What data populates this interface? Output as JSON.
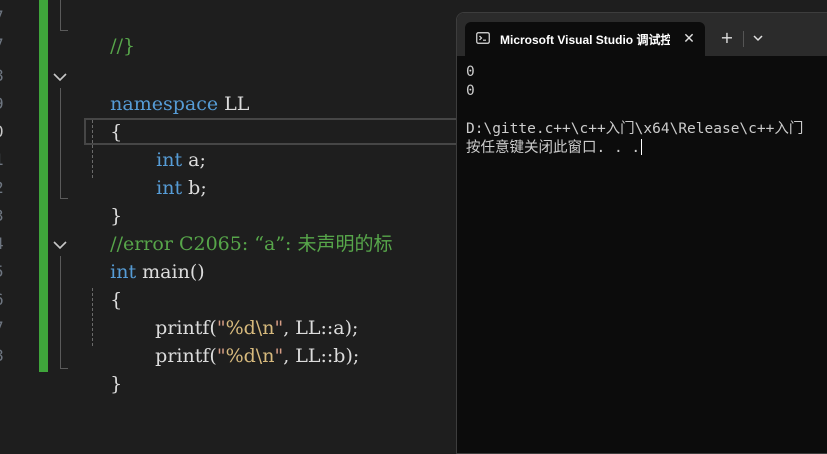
{
  "editor": {
    "lines": {
      "l1": {
        "text": "//}"
      },
      "l3": {
        "kw": "namespace",
        "name": " LL"
      },
      "l4": {
        "text": "{"
      },
      "l5": {
        "kw": "int",
        "rest": " a;"
      },
      "l6": {
        "kw": "int",
        "rest": " b;"
      },
      "l7": {
        "text": "}"
      },
      "l8": {
        "text": "//error C2065: “a”: 未声明的标"
      },
      "l9": {
        "kw": "int",
        "rest": " main()"
      },
      "l10": {
        "text": "{"
      },
      "l11": {
        "fn": "printf",
        "open": "(",
        "q1": "\"",
        "fmt": "%d\\n",
        "q2": "\"",
        "rest": ", LL::a);"
      },
      "l12": {
        "fn": "printf",
        "open": "(",
        "q1": "\"",
        "fmt": "%d\\n",
        "q2": "\"",
        "rest": ", LL::b);"
      },
      "l13": {
        "text": "}"
      }
    },
    "colors": {
      "keyword": "#569cd6",
      "comment": "#57a64a",
      "string": "#d69d85",
      "format": "#d7ba7d",
      "change_bar": "#3fa53b"
    }
  },
  "terminal": {
    "tab_title": "Microsoft Visual Studio 调试控",
    "tab_icon": "terminal-icon",
    "close_glyph": "✕",
    "new_tab_glyph": "+",
    "dropdown_icon": "chevron-down-icon",
    "output": [
      "0",
      "0",
      "",
      "D:\\gitte.c++\\c++入门\\x64\\Release\\c++入门",
      "按任意键关闭此窗口. . ."
    ]
  }
}
